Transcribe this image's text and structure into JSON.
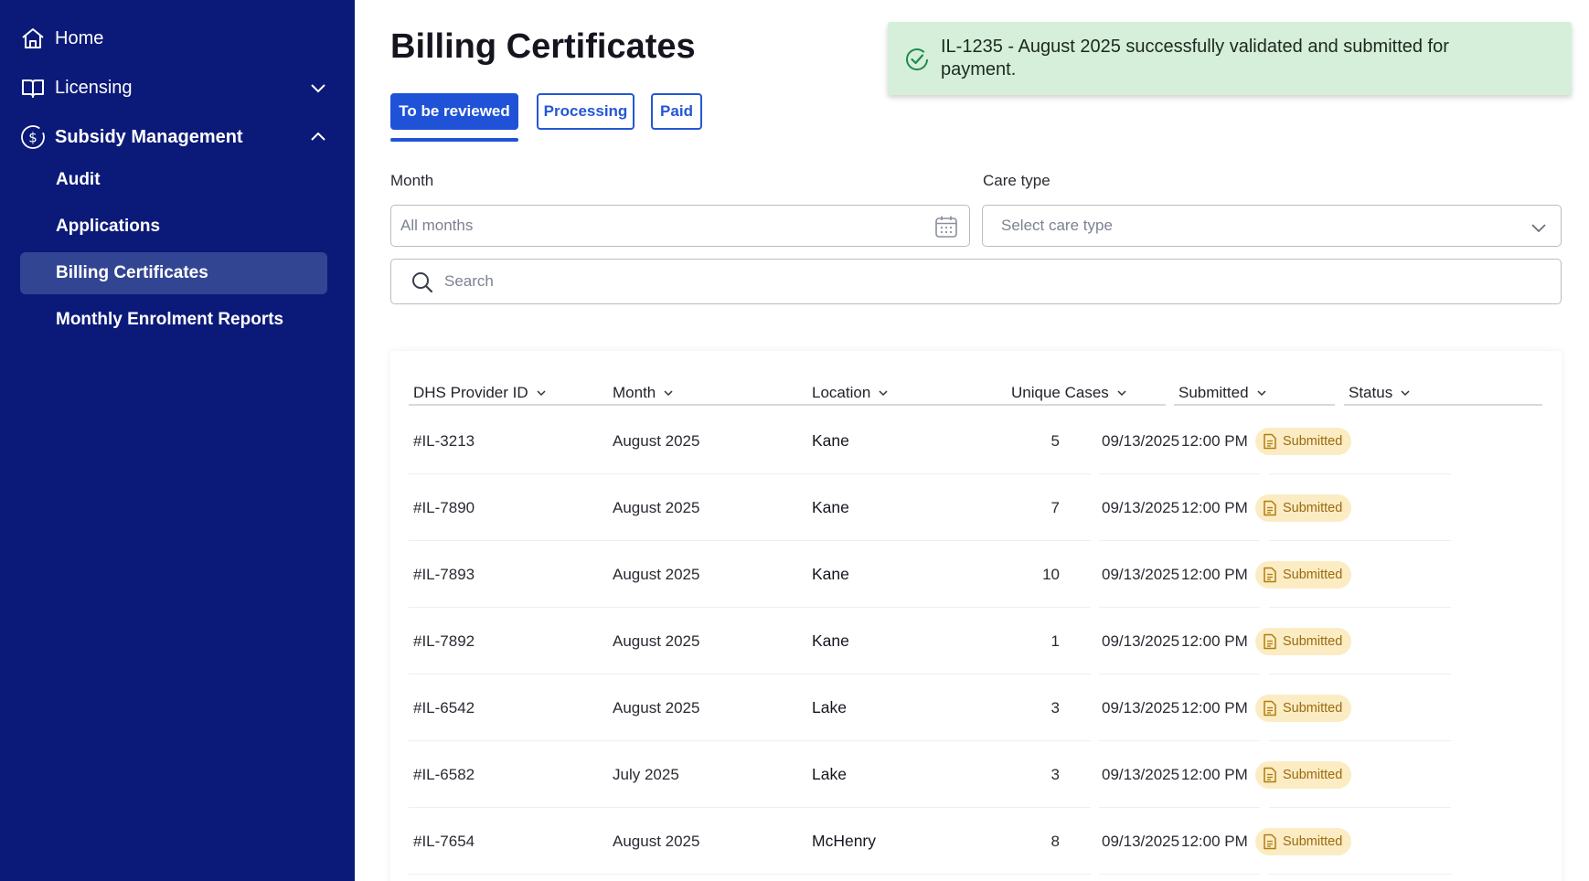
{
  "sidebar": {
    "home": "Home",
    "licensing": "Licensing",
    "subsidy": "Subsidy Management",
    "items": [
      "Audit",
      "Applications",
      "Billing Certificates",
      "Monthly Enrolment Reports"
    ]
  },
  "page": {
    "title": "Billing Certificates"
  },
  "tabs": [
    "To be reviewed",
    "Processing",
    "Paid"
  ],
  "toast": {
    "message": "IL-1235 - August 2025 successfully validated and submitted for payment."
  },
  "filters": {
    "month_label": "Month",
    "month_placeholder": "All months",
    "care_type_label": "Care type",
    "care_type_placeholder": "Select care type",
    "search_placeholder": "Search"
  },
  "table": {
    "headers": [
      "DHS Provider ID",
      "Month",
      "Location",
      "Unique Cases",
      "Submitted",
      "Status"
    ],
    "rows": [
      {
        "id": "#IL-3213",
        "month": "August 2025",
        "location": "Kane",
        "cases": "5",
        "date": "09/13/2025",
        "time": "12:00 PM",
        "status": "Submitted"
      },
      {
        "id": "#IL-7890",
        "month": "August 2025",
        "location": "Kane",
        "cases": "7",
        "date": "09/13/2025",
        "time": "12:00 PM",
        "status": "Submitted"
      },
      {
        "id": "#IL-7893",
        "month": "August 2025",
        "location": "Kane",
        "cases": "10",
        "date": "09/13/2025",
        "time": "12:00 PM",
        "status": "Submitted"
      },
      {
        "id": "#IL-7892",
        "month": "August 2025",
        "location": "Kane",
        "cases": "1",
        "date": "09/13/2025",
        "time": "12:00 PM",
        "status": "Submitted"
      },
      {
        "id": "#IL-6542",
        "month": "August 2025",
        "location": "Lake",
        "cases": "3",
        "date": "09/13/2025",
        "time": "12:00 PM",
        "status": "Submitted"
      },
      {
        "id": "#IL-6582",
        "month": "July 2025",
        "location": "Lake",
        "cases": "3",
        "date": "09/13/2025",
        "time": "12:00 PM",
        "status": "Submitted"
      },
      {
        "id": "#IL-7654",
        "month": "August 2025",
        "location": "McHenry",
        "cases": "8",
        "date": "09/13/2025",
        "time": "12:00 PM",
        "status": "Submitted"
      }
    ]
  },
  "colors": {
    "sidebar_bg": "#0b1a78",
    "sidebar_active": "#324593",
    "accent": "#1f52d6",
    "toast_bg": "#d6efdb",
    "badge_bg": "#fbecc4",
    "badge_text": "#9a6a0c"
  },
  "icons": {
    "home": "home-icon",
    "licensing": "book-icon",
    "subsidy": "dollar-circle-icon",
    "toast": "check-circle-icon",
    "calendar": "calendar-icon",
    "search": "search-icon",
    "status": "document-icon"
  }
}
